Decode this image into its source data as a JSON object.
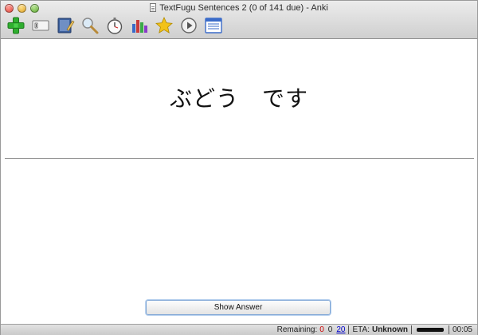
{
  "window": {
    "title": "TextFugu Sentences 2 (0 of 141 due) - Anki"
  },
  "toolbar": {
    "items": [
      {
        "icon": "add-icon",
        "color": "#2fae2f"
      },
      {
        "icon": "browse-icon"
      },
      {
        "icon": "edit-icon"
      },
      {
        "icon": "search-icon"
      },
      {
        "icon": "timer-icon"
      },
      {
        "icon": "statistics-icon"
      },
      {
        "icon": "star-icon",
        "color": "#f2c21a"
      },
      {
        "icon": "play-icon"
      },
      {
        "icon": "list-icon"
      }
    ]
  },
  "card": {
    "question": "ぶどう　です",
    "show_answer_label": "Show Answer"
  },
  "status": {
    "remaining_label": "Remaining:",
    "new_count": "0",
    "learning_count": "0",
    "review_count": "20",
    "eta_label": "ETA:",
    "eta_value": "Unknown",
    "progress": 1.0,
    "time": "00:05",
    "colors": {
      "new": "#cc0000",
      "review": "#0000cc"
    }
  }
}
